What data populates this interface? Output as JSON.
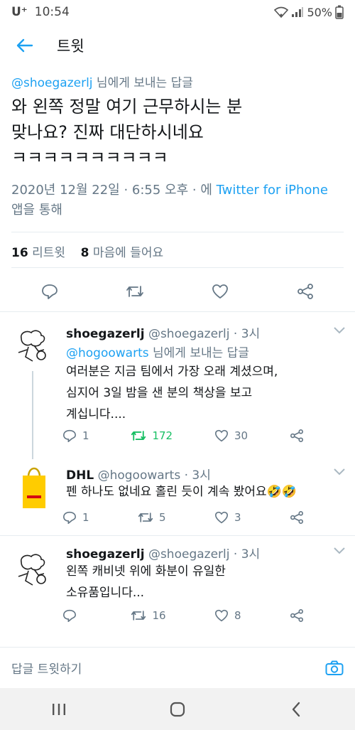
{
  "status": {
    "carrier": "U⁺",
    "time": "10:54",
    "battery": "50%"
  },
  "header": {
    "title": "트윗"
  },
  "tweet": {
    "reply_handle": "@shoegazerlj",
    "reply_suffix": " 님에게 보내는 답글",
    "text": "와 왼쪽 정말 여기 근무하시는 분\n맞나요? 진짜 대단하시네요\nㅋㅋㅋㅋㅋㅋㅋㅋㅋㅋ",
    "meta_prefix": "2020년 12월 22일 · 6:55 오후 · 에 ",
    "meta_link": "Twitter for iPhone",
    "meta_suffix": " 앱을 통해",
    "retweets": "16",
    "retweets_label": "리트윗",
    "likes": "8",
    "likes_label": "마음에 들어요"
  },
  "replies": [
    {
      "name": "shoegazerlj",
      "handle": "@shoegazerlj",
      "time": "· 3시",
      "reply_to": "@hogoowarts",
      "reply_suffix": " 님에게 보내는 답글",
      "text": "여러분은 지금 팀에서 가장 오래 계셨으며,\n심지어 3일 밤을 샌 분의 책상을 보고\n계십니다....",
      "replies": "1",
      "retweets": "172",
      "likes": "30"
    },
    {
      "name": "DHL",
      "handle": "@hogoowarts",
      "time": "· 3시",
      "text": "펜 하나도 없네요 홀린 듯이 계속 봤어요🤣🤣",
      "replies": "1",
      "retweets": "5",
      "likes": "3"
    },
    {
      "name": "shoegazerlj",
      "handle": "@shoegazerlj",
      "time": "· 3시",
      "text": "왼쪽 캐비넷 위에 화분이 유일한\n소유품입니다...",
      "replies": "",
      "retweets": "16",
      "likes": "8"
    }
  ],
  "compose": {
    "placeholder": "답글 트윗하기"
  },
  "colors": {
    "accent": "#1da1f2",
    "retweet_active": "#17bf63",
    "muted": "#657786"
  },
  "icons": [
    "back-arrow-icon",
    "reply-icon",
    "retweet-icon",
    "like-icon",
    "share-icon",
    "camera-icon",
    "chevron-down-icon",
    "recents-icon",
    "home-icon",
    "nav-back-icon"
  ]
}
